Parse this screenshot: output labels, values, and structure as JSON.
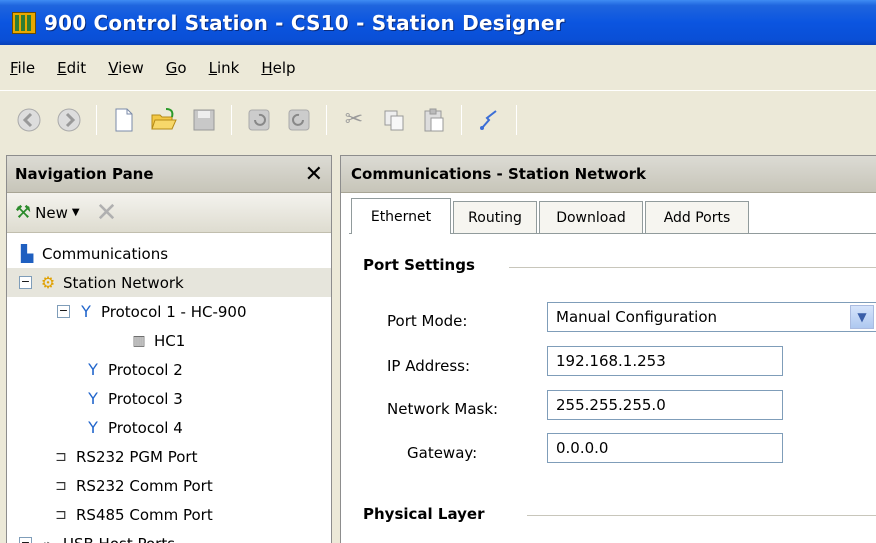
{
  "window": {
    "title": "900 Control Station - CS10 - Station Designer"
  },
  "menu": [
    "File",
    "Edit",
    "View",
    "Go",
    "Link",
    "Help"
  ],
  "toolbar_icons": [
    "back-icon",
    "forward-icon",
    "new-document-icon",
    "open-folder-icon",
    "save-icon",
    "undo-icon",
    "redo-icon",
    "cut-icon",
    "copy-icon",
    "paste-icon",
    "link-icon"
  ],
  "nav": {
    "title": "Navigation Pane",
    "new_label": "New",
    "tree": [
      {
        "label": "Communications",
        "icon": "communications-icon",
        "level": 0
      },
      {
        "label": "Station Network",
        "icon": "network-icon",
        "level": 0,
        "expander": "⊟",
        "selected": true
      },
      {
        "label": "Protocol 1 - HC-900",
        "icon": "protocol-icon",
        "level": 1,
        "expander": "⊟"
      },
      {
        "label": "HC1",
        "icon": "controller-icon",
        "level": 2
      },
      {
        "label": "Protocol 2",
        "icon": "protocol-icon",
        "level": 1
      },
      {
        "label": "Protocol 3",
        "icon": "protocol-icon",
        "level": 1
      },
      {
        "label": "Protocol 4",
        "icon": "protocol-icon",
        "level": 1
      },
      {
        "label": "RS232 PGM Port",
        "icon": "serial-port-icon",
        "level": 1
      },
      {
        "label": "RS232 Comm Port",
        "icon": "serial-port-icon",
        "level": 1
      },
      {
        "label": "RS485 Comm Port",
        "icon": "serial-port-icon",
        "level": 1
      },
      {
        "label": "USB Host Ports",
        "icon": "usb-icon",
        "level": 0,
        "expander": "⊟"
      }
    ]
  },
  "content": {
    "title": "Communications - Station Network",
    "tabs": [
      "Ethernet",
      "Routing",
      "Download",
      "Add Ports"
    ],
    "active_tab": "Ethernet",
    "port_settings": {
      "heading": "Port Settings",
      "port_mode_label": "Port Mode:",
      "port_mode_value": "Manual Configuration",
      "ip_label": "IP Address:",
      "ip_value": "192.168.1.253",
      "mask_label": "Network Mask:",
      "mask_value": "255.255.255.0",
      "gateway_label": "Gateway:",
      "gateway_value": "0.0.0.0"
    },
    "physical_layer_heading": "Physical Layer"
  }
}
